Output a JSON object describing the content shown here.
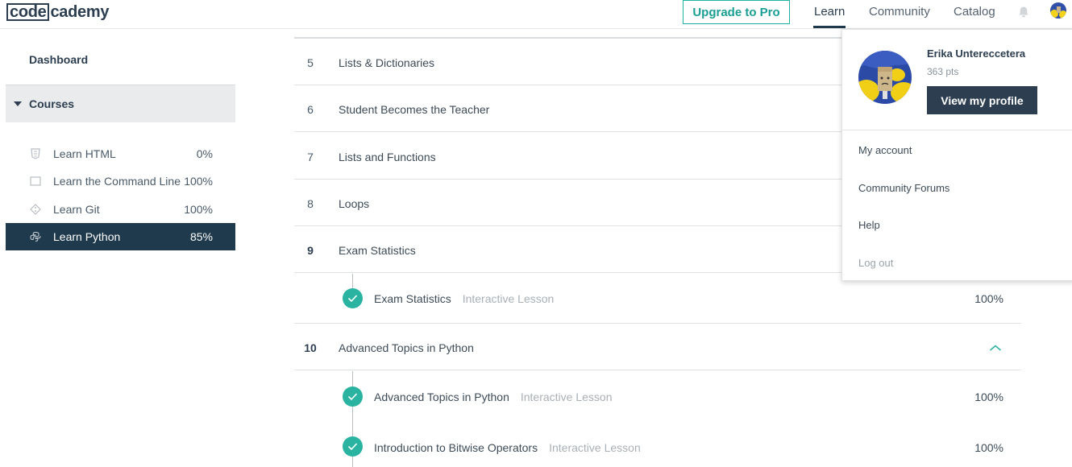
{
  "header": {
    "logo_boxed": "code",
    "logo_rest": "cademy",
    "upgrade_label": "Upgrade to Pro",
    "nav": [
      {
        "label": "Learn"
      },
      {
        "label": "Community"
      },
      {
        "label": "Catalog"
      }
    ],
    "accent_color": "#1eb2a6"
  },
  "sidebar": {
    "dashboard_label": "Dashboard",
    "courses_label": "Courses",
    "courses": [
      {
        "name": "Learn HTML",
        "percent": "0%",
        "icon": "html5-icon"
      },
      {
        "name": "Learn the Command Line",
        "percent": "100%",
        "icon": "terminal-icon"
      },
      {
        "name": "Learn Git",
        "percent": "100%",
        "icon": "git-icon"
      },
      {
        "name": "Learn Python",
        "percent": "85%",
        "icon": "python-icon",
        "active": true
      }
    ]
  },
  "units": [
    {
      "number": "5",
      "title": "Lists & Dictionaries"
    },
    {
      "number": "6",
      "title": "Student Becomes the Teacher"
    },
    {
      "number": "7",
      "title": "Lists and Functions"
    },
    {
      "number": "8",
      "title": "Loops"
    },
    {
      "number": "9",
      "title": "Exam Statistics",
      "lessons": [
        {
          "title": "Exam Statistics",
          "type": "Interactive Lesson",
          "percent": "100%"
        }
      ]
    },
    {
      "number": "10",
      "title": "Advanced Topics in Python",
      "expanded": true,
      "lessons": [
        {
          "title": "Advanced Topics in Python",
          "type": "Interactive Lesson",
          "percent": "100%"
        },
        {
          "title": "Introduction to Bitwise Operators",
          "type": "Interactive Lesson",
          "percent": "100%"
        }
      ]
    }
  ],
  "user_menu": {
    "name": "Erika Untereccetera",
    "points": "363 pts",
    "profile_button": "View my profile",
    "items": [
      {
        "label": "My account"
      },
      {
        "label": "Community Forums"
      },
      {
        "label": "Help"
      },
      {
        "label": "Log out"
      }
    ]
  }
}
